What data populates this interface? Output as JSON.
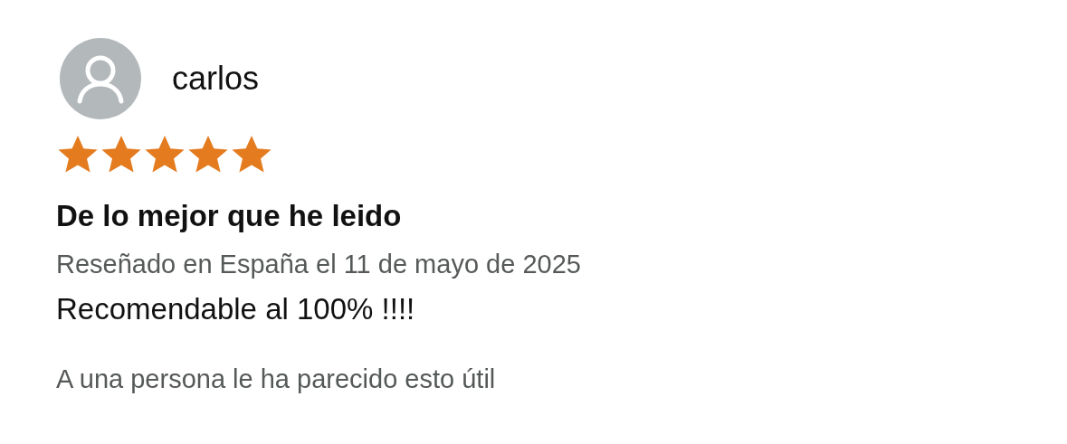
{
  "review": {
    "author": "carlos",
    "stars": 5,
    "title": "De lo mejor que he leido",
    "meta": "Reseñado en España el 11 de mayo de 2025",
    "body": "Recomendable al 100% !!!!",
    "helpful": "A una persona le ha parecido esto útil"
  }
}
